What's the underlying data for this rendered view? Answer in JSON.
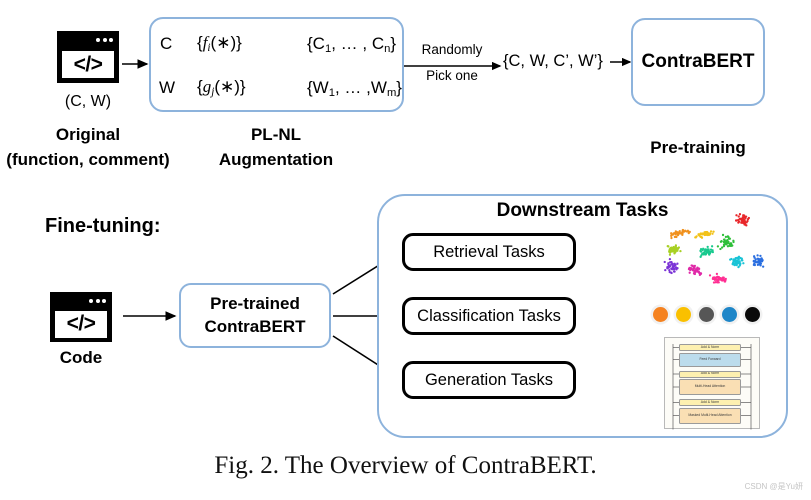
{
  "figure": {
    "caption": "Fig. 2. The Overview of ContraBERT.",
    "watermark": "CSDN @是Yu妍",
    "accent_blue": "#8DB3DC",
    "outline_black": "#000000"
  },
  "pretraining": {
    "source_icon": {
      "name": "code-window-icon",
      "glyph": "</>"
    },
    "source_pair_label": "(C, W)",
    "source_title": "Original",
    "source_subtitle": "(function, comment)",
    "augmentation": {
      "title_line1": "PL-NL",
      "title_line2": "Augmentation",
      "rows": [
        {
          "input": "C",
          "operator_open": "{",
          "operator_fn": "f",
          "operator_sub": "i",
          "operator_args": "(*)",
          "operator_close": "}",
          "output": "{C₁, … , Cₙ}"
        },
        {
          "input": "W",
          "operator_open": "{",
          "operator_fn": "g",
          "operator_sub": "j",
          "operator_args": "(*)",
          "operator_close": "}",
          "output": "{W₁, … ,Wₘ}"
        }
      ]
    },
    "selection": {
      "label_top": "Randomly",
      "label_bottom": "Pick one"
    },
    "selected_set": "{C, W, C’, W’}",
    "model_box_label": "ContraBERT",
    "stage_label": "Pre-training"
  },
  "finetuning": {
    "section_label": "Fine-tuning:",
    "source_icon": {
      "name": "code-window-icon",
      "glyph": "</>"
    },
    "source_caption": "Code",
    "model_box_line1": "Pre-trained",
    "model_box_line2": "ContraBERT",
    "downstream": {
      "title": "Downstream Tasks",
      "tasks": [
        {
          "label": "Retrieval Tasks",
          "result_kind": "tsne-cluster-plot"
        },
        {
          "label": "Classification Tasks",
          "result_kind": "class-dots"
        },
        {
          "label": "Generation Tasks",
          "result_kind": "transformer-diagram"
        }
      ]
    }
  },
  "visuals": {
    "tsne_cluster_colors": [
      "#e8262a",
      "#f0911e",
      "#f2c21a",
      "#a8d024",
      "#2fbf3a",
      "#18c98e",
      "#19c3d6",
      "#2b6fe0",
      "#7b34d6",
      "#e02aa8",
      "#ff2f93"
    ],
    "classification_dot_colors": [
      "#F58220",
      "#FAC000",
      "#565656",
      "#1E86C8",
      "#0A0A0A"
    ],
    "transformer_blocks": [
      {
        "text": "Add & Norm",
        "style": "norm"
      },
      {
        "text": "Feed Forward",
        "style": "ff"
      },
      {
        "text": "Add & Norm",
        "style": "norm"
      },
      {
        "text": "Multi-Head Attention",
        "style": "attn"
      },
      {
        "text": "Add & Norm",
        "style": "norm"
      },
      {
        "text": "Masked Multi-Head Attention",
        "style": "attn"
      }
    ]
  }
}
